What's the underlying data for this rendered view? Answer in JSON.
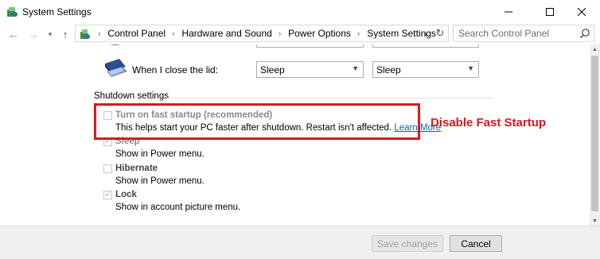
{
  "window": {
    "title": "System Settings"
  },
  "address_bar": {
    "crumbs": [
      "Control Panel",
      "Hardware and Sound",
      "Power Options",
      "System Settings"
    ]
  },
  "search": {
    "placeholder": "Search Control Panel"
  },
  "lid": {
    "label": "When I close the lid:",
    "plugged_in": "Sleep",
    "on_battery": "Sleep"
  },
  "shutdown": {
    "section_title": "Shutdown settings",
    "options": [
      {
        "title": "Turn on fast startup (recommended)",
        "desc": "This helps start your PC faster after shutdown. Restart isn't affected.",
        "link": "Learn More",
        "checked": false
      },
      {
        "title": "Sleep",
        "desc": "Show in Power menu.",
        "checked": true
      },
      {
        "title": "Hibernate",
        "desc": "Show in Power menu.",
        "checked": false
      },
      {
        "title": "Lock",
        "desc": "Show in account picture menu.",
        "checked": true
      }
    ]
  },
  "annotation": {
    "text": "Disable Fast Startup",
    "color": "#e0141e"
  },
  "footer": {
    "save_label": "Save changes",
    "cancel_label": "Cancel"
  }
}
